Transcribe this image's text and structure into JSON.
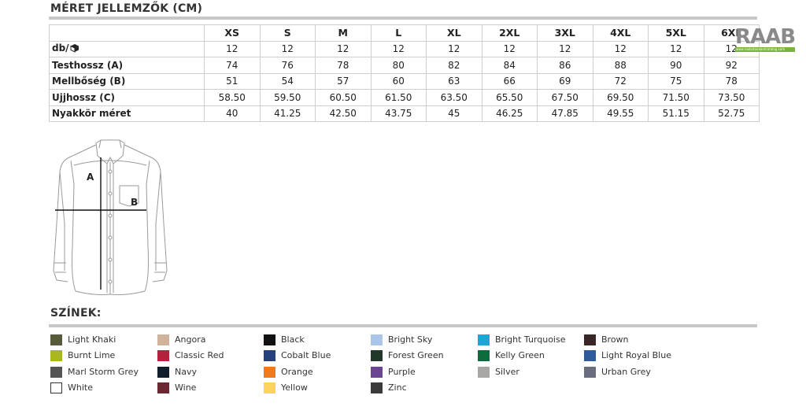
{
  "size_section": {
    "title": "MÉRET JELLEMZŐK (CM)",
    "sizes": [
      "XS",
      "S",
      "M",
      "L",
      "XL",
      "2XL",
      "3XL",
      "4XL",
      "5XL",
      "6XL"
    ],
    "rows": [
      {
        "label": "db/",
        "icon": "box-icon",
        "values": [
          "12",
          "12",
          "12",
          "12",
          "12",
          "12",
          "12",
          "12",
          "12",
          "12"
        ]
      },
      {
        "label": "Testhossz (A)",
        "values": [
          "74",
          "76",
          "78",
          "80",
          "82",
          "84",
          "86",
          "88",
          "90",
          "92"
        ]
      },
      {
        "label": "Mellbőség (B)",
        "values": [
          "51",
          "54",
          "57",
          "60",
          "63",
          "66",
          "69",
          "72",
          "75",
          "78"
        ]
      },
      {
        "label": "Ujjhossz (C)",
        "values": [
          "58.50",
          "59.50",
          "60.50",
          "61.50",
          "63.50",
          "65.50",
          "67.50",
          "69.50",
          "71.50",
          "73.50"
        ]
      },
      {
        "label": "Nyakkör méret",
        "values": [
          "40",
          "41.25",
          "42.50",
          "43.75",
          "45",
          "46.25",
          "47.85",
          "49.55",
          "51.15",
          "52.75"
        ]
      }
    ]
  },
  "diagram": {
    "label_a": "A",
    "label_b": "B"
  },
  "logo": {
    "text": "RAAB",
    "url": "www.raabstandardcatalog.com"
  },
  "colors_section": {
    "title": "SZÍNEK:",
    "swatches": [
      {
        "name": "Light Khaki",
        "hex": "#585a3c"
      },
      {
        "name": "Angora",
        "hex": "#cfb49b"
      },
      {
        "name": "Black",
        "hex": "#111111"
      },
      {
        "name": "Bright Sky",
        "hex": "#a9c6e8"
      },
      {
        "name": "Bright Turquoise",
        "hex": "#1ba8d6"
      },
      {
        "name": "Brown",
        "hex": "#3a2527"
      },
      {
        "name": "Burnt Lime",
        "hex": "#a8b81e"
      },
      {
        "name": "Classic Red",
        "hex": "#b5203c"
      },
      {
        "name": "Cobalt Blue",
        "hex": "#26417e"
      },
      {
        "name": "Forest Green",
        "hex": "#213829"
      },
      {
        "name": "Kelly Green",
        "hex": "#0e6b3e"
      },
      {
        "name": "Light Royal Blue",
        "hex": "#2f5a9c"
      },
      {
        "name": "Marl Storm Grey",
        "hex": "#545454"
      },
      {
        "name": "Navy",
        "hex": "#0f1d2c"
      },
      {
        "name": "Orange",
        "hex": "#f27a1a"
      },
      {
        "name": "Purple",
        "hex": "#6b4690"
      },
      {
        "name": "Silver",
        "hex": "#a9a6a5"
      },
      {
        "name": "Urban Grey",
        "hex": "#6a6d7d"
      },
      {
        "name": "White",
        "hex": "#ffffff"
      },
      {
        "name": "Wine",
        "hex": "#6c2831"
      },
      {
        "name": "Yellow",
        "hex": "#fdd35a"
      },
      {
        "name": "Zinc",
        "hex": "#3b3b3b"
      }
    ]
  }
}
